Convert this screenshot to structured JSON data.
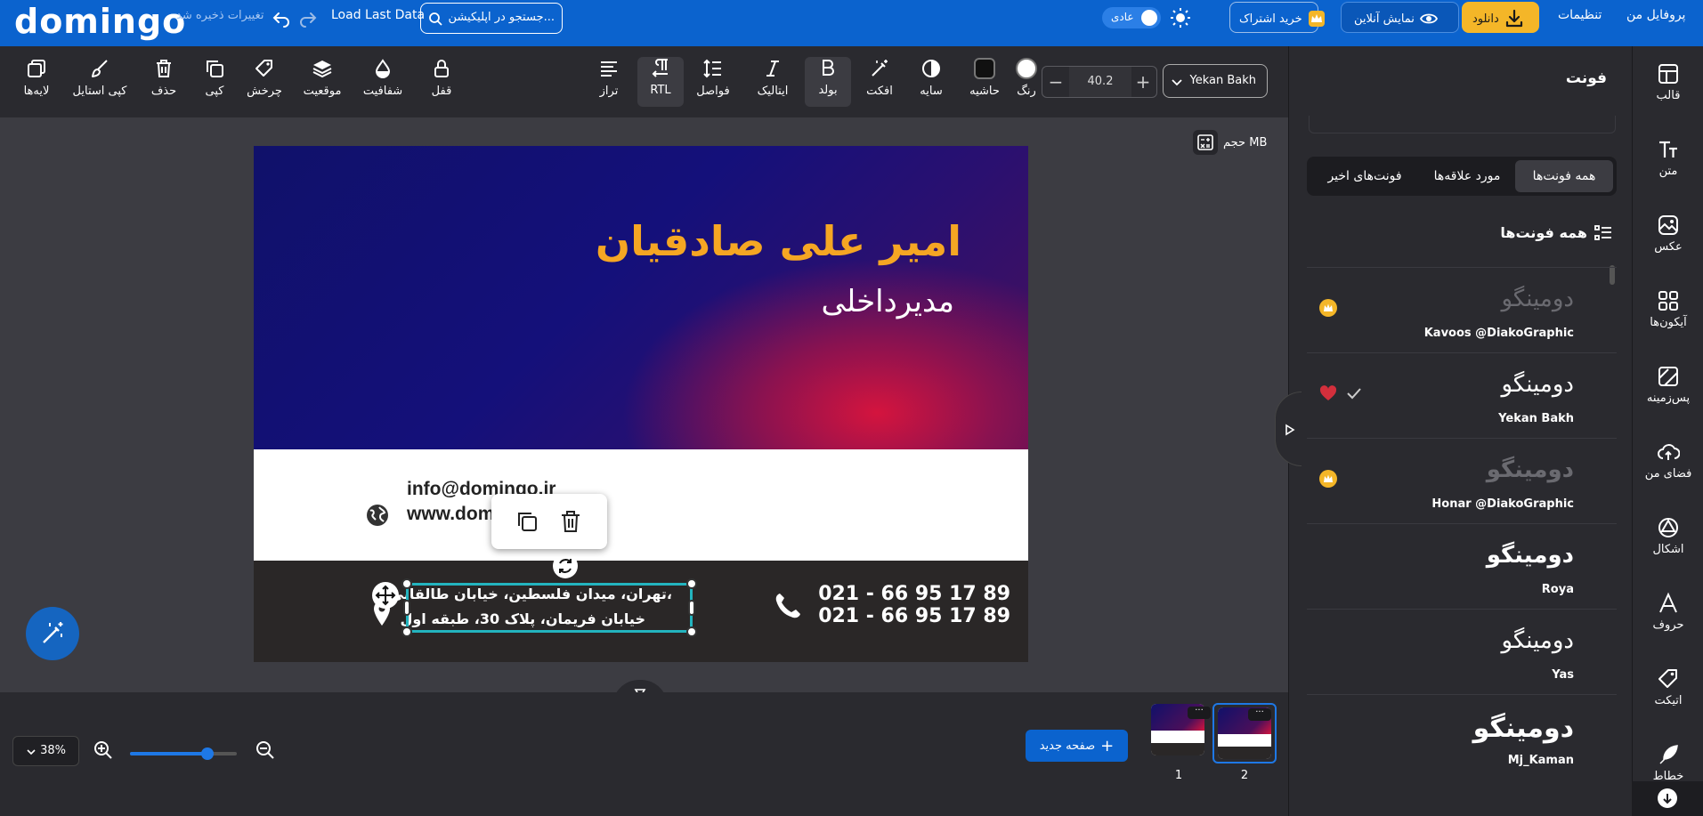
{
  "topbar": {
    "logo": "domingo",
    "save_status": "تغییرات ذخیره شد",
    "load_last": "Load Last Data",
    "search_placeholder": "جستجو در اپلیکیشن...",
    "theme_label": "عادی",
    "subscribe_label": "خرید اشتراک",
    "preview_label": "نمایش آنلاین",
    "download_label": "دانلود",
    "settings_label": "تنظیمات",
    "profile_label": "پروفایل من",
    "accent_color": "#0b63ce",
    "download_color": "#f4b628"
  },
  "toolbar": {
    "layers": "لایه‌ها",
    "copy_style": "کپی استایل",
    "delete": "حذف",
    "copy": "کپی",
    "rotate": "چرخش",
    "position": "موقعیت",
    "opacity": "شفافیت",
    "lock": "قفل",
    "align": "تراز",
    "rtl": "RTL",
    "spacing": "فواصل",
    "italic": "ایتالیک",
    "bold": "بولد",
    "effect": "افکت",
    "shadow": "سایه",
    "border": "حاشیه",
    "color": "رنگ",
    "font_size": "40.2",
    "font_family": "Yekan Bakh"
  },
  "canvas": {
    "size_label": "حجم MB",
    "card": {
      "name": "امیر علی صادقیان",
      "job_title": "مدیرداخلی",
      "email": "info@domingo.ir",
      "website": "www.domingo.ir",
      "phone1": "021 - 66 95 17 89",
      "phone2": "021 - 66 95 17 89",
      "address_line1": "تهران، میدان فلسطین، خیابان طالقانی،",
      "address_line2": "خیابان فریمان، پلاک 30، طبقه اول",
      "name_color": "#f5a623"
    }
  },
  "bottombar": {
    "zoom": "38%",
    "zoom_fraction": 0.38,
    "new_page": "صفحه جدید",
    "pages": [
      {
        "number": "1",
        "menu": "···"
      },
      {
        "number": "2",
        "menu": "···"
      }
    ]
  },
  "font_panel": {
    "title": "فونت",
    "tabs": [
      "همه فونت‌ها",
      "مورد علاقه‌ها",
      "فونت‌های اخیر"
    ],
    "section_title": "همه فونت‌ها",
    "fonts": [
      {
        "sample": "دومینگو",
        "name": "Kavoos @DiakoGraphic",
        "premium": true,
        "selected": false
      },
      {
        "sample": "دومینگو",
        "name": "Yekan Bakh",
        "premium": false,
        "selected": true
      },
      {
        "sample": "دومینگو",
        "name": "Honar @DiakoGraphic",
        "premium": true,
        "selected": false
      },
      {
        "sample": "دومینگو",
        "name": "Roya",
        "premium": false,
        "selected": false
      },
      {
        "sample": "دومینگو",
        "name": "Yas",
        "premium": false,
        "selected": false
      },
      {
        "sample": "دومینگو",
        "name": "Mj_Kaman",
        "premium": false,
        "selected": false
      }
    ]
  },
  "rail": {
    "items": [
      "قالب",
      "متن",
      "عکس",
      "آیکون‌ها",
      "پس‌زمینه",
      "فضای من",
      "اشکال",
      "حروف",
      "اتیکت",
      "خطاط"
    ]
  }
}
